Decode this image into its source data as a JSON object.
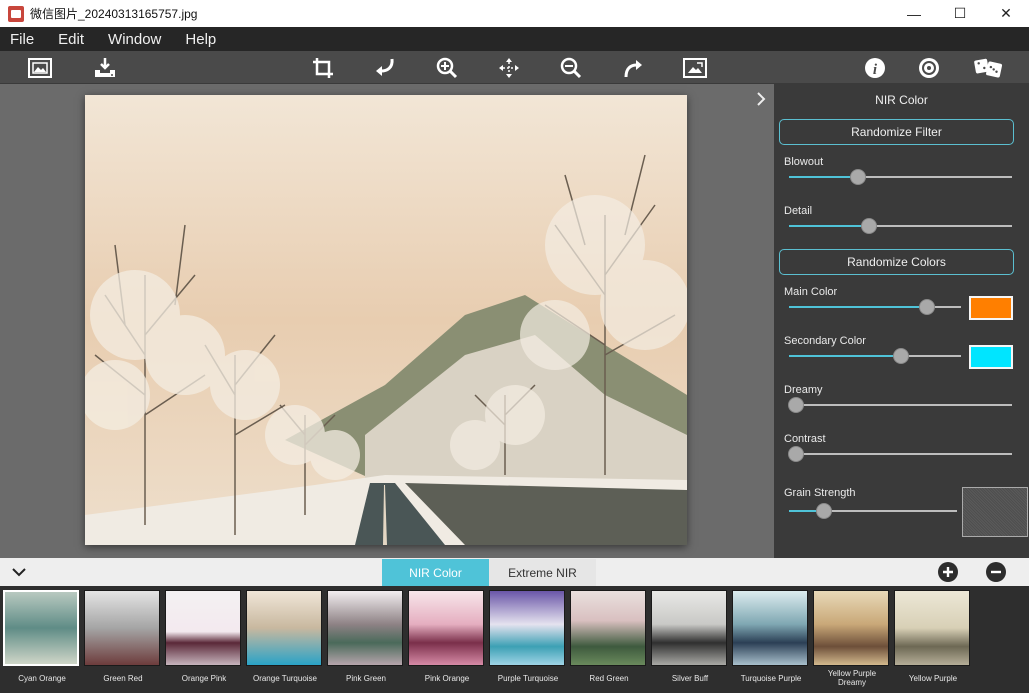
{
  "window": {
    "title": "微信图片_20240313165757.jpg",
    "minimize": "—",
    "maximize": "☐",
    "close": "✕"
  },
  "menu": [
    "File",
    "Edit",
    "Window",
    "Help"
  ],
  "toolbar": {
    "left": [
      "open-image-icon",
      "save-download-icon"
    ],
    "center": [
      "crop-icon",
      "undo-icon",
      "zoom-in-icon",
      "pan-move-icon",
      "zoom-out-icon",
      "redo-icon",
      "fit-image-icon"
    ],
    "right": [
      "info-icon",
      "settings-icon",
      "randomize-dice-icon"
    ]
  },
  "panel": {
    "title": "NIR Color",
    "randomize_filter": "Randomize Filter",
    "randomize_colors": "Randomize Colors",
    "sliders": {
      "blowout": {
        "label": "Blowout",
        "value": 0.31
      },
      "detail": {
        "label": "Detail",
        "value": 0.36
      },
      "main_color": {
        "label": "Main Color",
        "value": 0.8
      },
      "secondary_color": {
        "label": "Secondary Color",
        "value": 0.65
      },
      "dreamy": {
        "label": "Dreamy",
        "value": 0.0
      },
      "contrast": {
        "label": "Contrast",
        "value": 0.0
      },
      "grain_strength": {
        "label": "Grain Strength",
        "value": 0.21
      }
    },
    "colors": {
      "main": "#ff7f00",
      "secondary": "#00e5ff"
    }
  },
  "tabs": {
    "active": "NIR Color",
    "inactive": "Extreme NIR"
  },
  "presets": [
    {
      "label": "Cyan Orange",
      "selected": true
    },
    {
      "label": "Green Red"
    },
    {
      "label": "Orange Pink"
    },
    {
      "label": "Orange Turquoise"
    },
    {
      "label": "Pink Green"
    },
    {
      "label": "Pink Orange"
    },
    {
      "label": "Purple Turquoise"
    },
    {
      "label": "Red Green"
    },
    {
      "label": "Silver Buff"
    },
    {
      "label": "Turquoise Purple"
    },
    {
      "label": "Yellow Purple Dreamy"
    },
    {
      "label": "Yellow Purple"
    }
  ],
  "accent": "#4fc3d8"
}
